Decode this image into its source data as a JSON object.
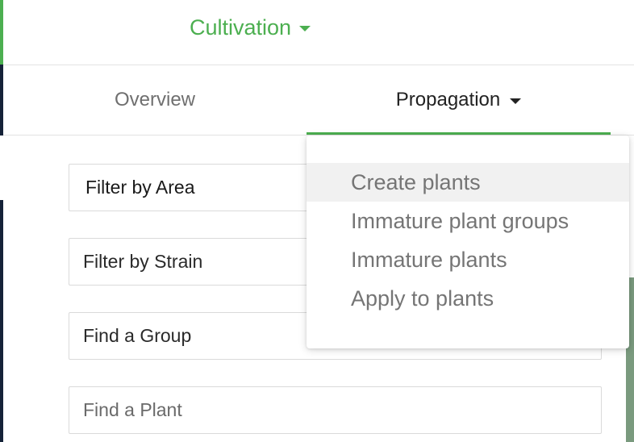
{
  "header": {
    "module_label": "Cultivation",
    "module_caret_icon": "caret-down-icon",
    "accent_color": "#4caf50"
  },
  "tabs": [
    {
      "label": "Overview",
      "active": false
    },
    {
      "label": "Propagation",
      "active": true,
      "has_dropdown": true
    }
  ],
  "filters": {
    "area_label": "Filter by Area",
    "strain_label": "Filter by Strain",
    "group_label": "Find a Group",
    "plant_placeholder": "Find a Plant"
  },
  "propagation_menu": {
    "items": [
      {
        "label": "Create plants",
        "highlighted": true
      },
      {
        "label": "Immature plant groups",
        "highlighted": false
      },
      {
        "label": "Immature plants",
        "highlighted": false
      },
      {
        "label": "Apply to plants",
        "highlighted": false
      }
    ]
  }
}
